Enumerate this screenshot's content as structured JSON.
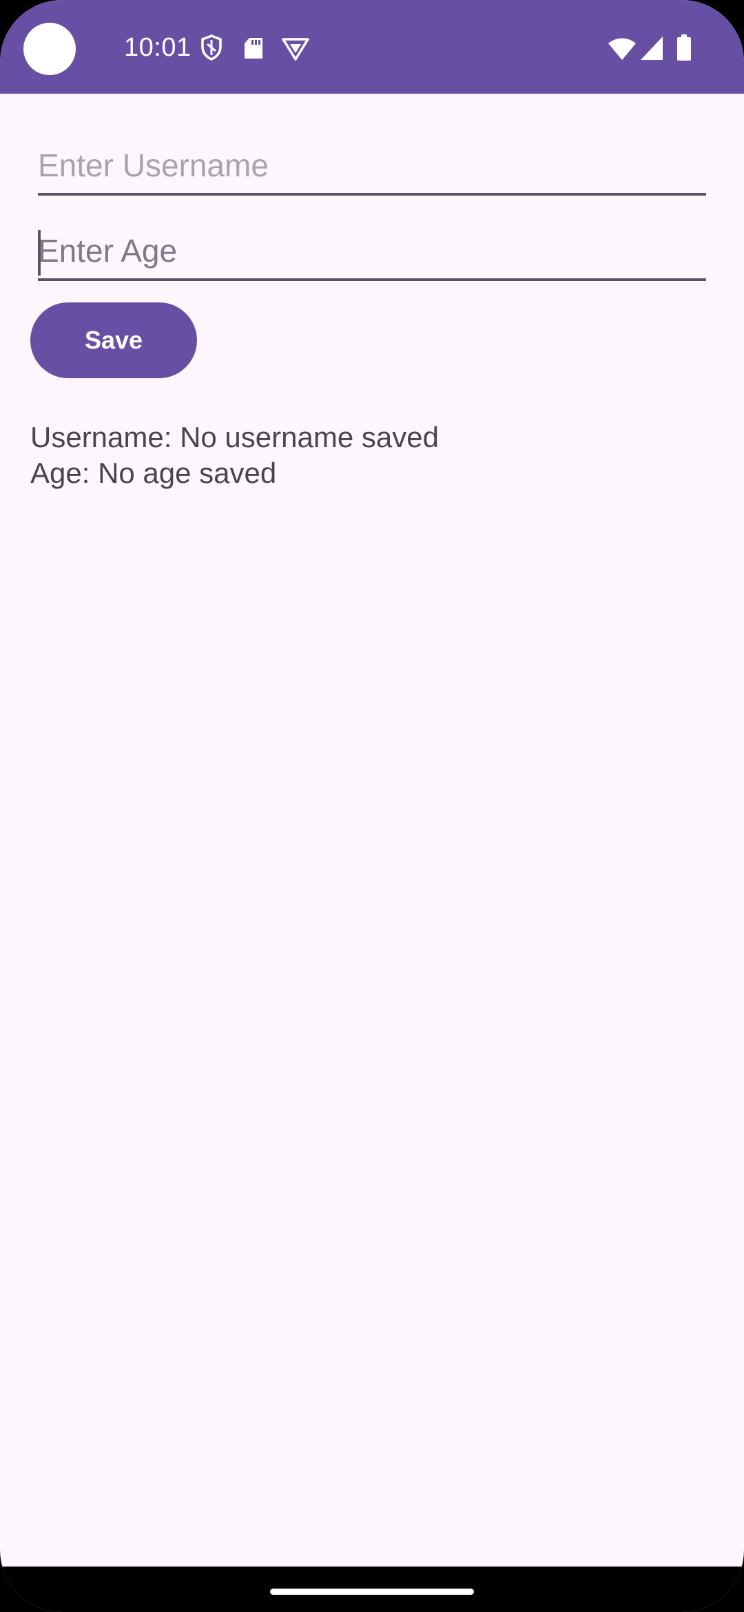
{
  "status_bar": {
    "time": "10:01",
    "left_icons": [
      "shield-icon",
      "sd-card-icon",
      "vpn-badge-icon"
    ],
    "right_icons": [
      "wifi-icon",
      "cell-signal-icon",
      "battery-icon"
    ],
    "background_color": "#6750A4"
  },
  "form": {
    "username_field": {
      "placeholder": "Enter Username",
      "value": ""
    },
    "age_field": {
      "placeholder": "Enter Age",
      "value": ""
    },
    "save_label": "Save"
  },
  "saved_info": {
    "username_line": "Username: No username saved",
    "age_line": "Age: No age saved"
  },
  "colors": {
    "accent": "#6750A4",
    "background": "#FDF7FD",
    "text": "#49454F"
  }
}
